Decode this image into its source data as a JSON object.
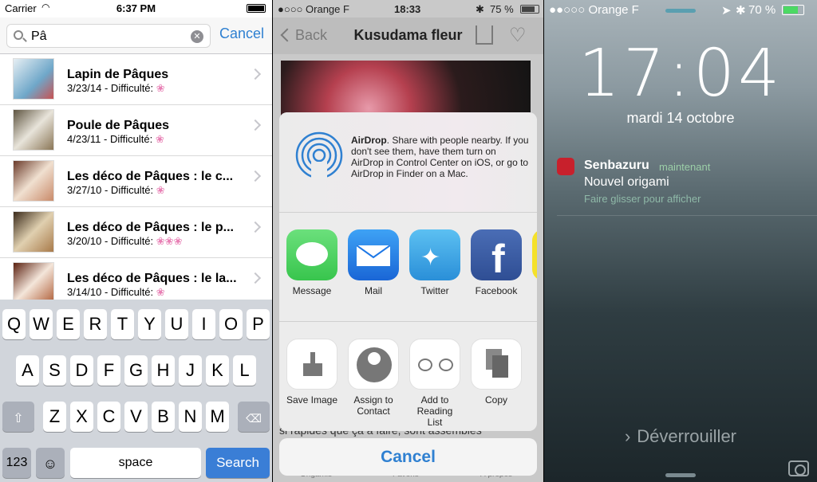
{
  "p1": {
    "status": {
      "carrier": "Carrier",
      "time": "6:37 PM"
    },
    "search": {
      "query": "Pâ",
      "cancel": "Cancel"
    },
    "rows": [
      {
        "title": "Lapin de Pâques",
        "meta": "3/23/14 - Difficulté:",
        "flowers": "❀",
        "thumb_color": "#6fa7c9"
      },
      {
        "title": "Poule de Pâques",
        "meta": "4/23/11 - Difficulté:",
        "flowers": "❀",
        "thumb_color": "#8a7656"
      },
      {
        "title": "Les déco de Pâques : le c...",
        "meta": "3/27/10 - Difficulté:",
        "flowers": "❀",
        "thumb_color": "#c98a6a"
      },
      {
        "title": "Les déco de Pâques : le p...",
        "meta": "3/20/10 - Difficulté:",
        "flowers": "❀❀❀",
        "thumb_color": "#a87a4a"
      },
      {
        "title": "Les déco de Pâques : le la...",
        "meta": "3/14/10 - Difficulté:",
        "flowers": "❀",
        "thumb_color": "#b0603a"
      }
    ],
    "keyboard": {
      "row1": [
        "Q",
        "W",
        "E",
        "R",
        "T",
        "Y",
        "U",
        "I",
        "O",
        "P"
      ],
      "row2": [
        "A",
        "S",
        "D",
        "F",
        "G",
        "H",
        "J",
        "K",
        "L"
      ],
      "row3": [
        "Z",
        "X",
        "C",
        "V",
        "B",
        "N",
        "M"
      ],
      "num": "123",
      "space": "space",
      "search": "Search"
    }
  },
  "p2": {
    "status": {
      "carrier": "●○○○ Orange F",
      "time": "18:33",
      "battery": "75 %"
    },
    "nav": {
      "back": "Back",
      "title": "Kusudama fleur"
    },
    "airdrop": {
      "title": "AirDrop",
      "text": ". Share with people nearby. If you don't see them, have them turn on AirDrop in Control Center on iOS, or go to AirDrop in Finder on a Mac."
    },
    "apps": [
      {
        "label": "Message",
        "color": "#4cd964"
      },
      {
        "label": "Mail",
        "color": "#1e78e6"
      },
      {
        "label": "Twitter",
        "color": "#3aa6e8"
      },
      {
        "label": "Facebook",
        "color": "#3b5ba0"
      }
    ],
    "actions": [
      {
        "label": "Save Image"
      },
      {
        "label": "Assign to Contact"
      },
      {
        "label": "Add to Reading List"
      },
      {
        "label": "Copy"
      }
    ],
    "under_text": "si rapides que ça à faire, sont assemblés",
    "cancel": "Cancel",
    "tabs": [
      "Origamis",
      "Favoris",
      "À propos"
    ]
  },
  "p3": {
    "status": {
      "carrier": "●●○○○ Orange F",
      "battery": "70 %"
    },
    "time": "17:04",
    "date": "mardi 14 octobre",
    "notification": {
      "app": "Senbazuru",
      "time": "maintenant",
      "message": "Nouvel origami",
      "hint": "Faire glisser pour afficher"
    },
    "unlock": "Déverrouiller"
  }
}
